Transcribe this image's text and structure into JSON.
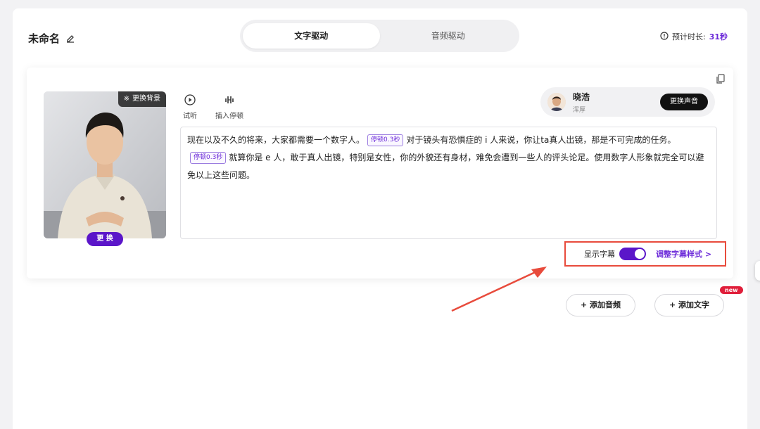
{
  "header": {
    "title": "未命名",
    "tabs": [
      {
        "label": "文字驱动",
        "active": true
      },
      {
        "label": "音频驱动",
        "active": false
      }
    ],
    "duration_label": "预计时长:",
    "duration_value": "31秒"
  },
  "avatar": {
    "change_bg_label": "更换背景",
    "swap_label": "更 换"
  },
  "tools": {
    "preview_label": "试听",
    "insert_pause_label": "插入停顿"
  },
  "voice": {
    "name": "晓浩",
    "style": "浑厚",
    "change_label": "更换声音"
  },
  "script": {
    "part1": "现在以及不久的将来，大家都需要一个数字人。",
    "pause1": "停顿0.3秒",
    "part2": "对于镜头有恐惧症的 i 人来说，你让ta真人出镜，那是不可完成的任务。",
    "pause2": "停顿0.3秒",
    "part3": "就算你是 e 人，敢于真人出镜，特别是女性，你的外貌还有身材，难免会遭到一些人的评头论足。使用数字人形象就完全可以避免以上这些问题。"
  },
  "subtitles": {
    "show_label": "显示字幕",
    "enabled": true,
    "adjust_label": "调整字幕样式 >"
  },
  "actions": {
    "add_audio_label": "+ 添加音频",
    "add_text_label": "+ 添加文字",
    "new_badge": "new"
  },
  "colors": {
    "accent": "#5b16c9",
    "highlight_box": "#e84b3c"
  }
}
